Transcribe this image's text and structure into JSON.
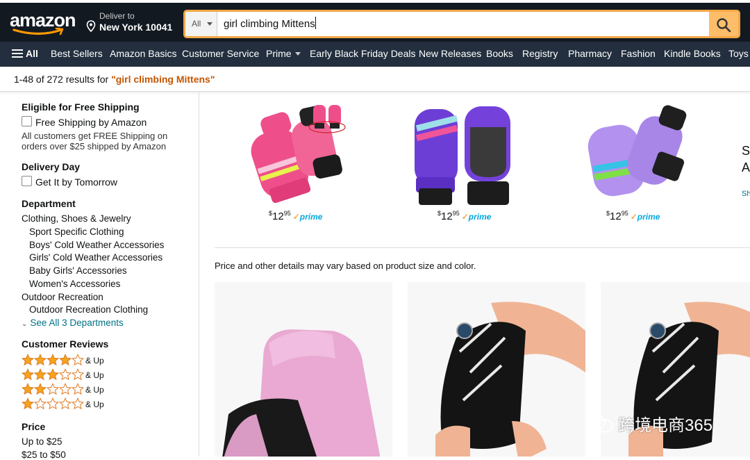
{
  "header": {
    "logo_text": "amazon",
    "deliver_label": "Deliver to",
    "deliver_location": "New York 10041",
    "search_category": "All",
    "search_query": "girl climbing Mittens"
  },
  "nav": {
    "items": [
      "All",
      "Best Sellers",
      "Amazon Basics",
      "Customer Service",
      "Prime",
      "Early Black Friday Deals",
      "New Releases",
      "Books",
      "Registry",
      "Pharmacy",
      "Fashion",
      "Kindle Books",
      "Toys"
    ]
  },
  "results": {
    "count_text": "1-48 of 272 results for ",
    "query_text": "\"girl climbing Mittens\""
  },
  "sidebar": {
    "shipping_heading": "Eligible for Free Shipping",
    "shipping_option": "Free Shipping by Amazon",
    "shipping_note": "All customers get FREE Shipping on orders over $25 shipped by Amazon",
    "delivery_heading": "Delivery Day",
    "delivery_option": "Get It by Tomorrow",
    "department_heading": "Department",
    "departments": [
      {
        "label": "Clothing, Shoes & Jewelry"
      },
      {
        "label": "Sport Specific Clothing"
      },
      {
        "label": "Boys' Cold Weather Accessories"
      },
      {
        "label": "Girls' Cold Weather Accessories"
      },
      {
        "label": "Baby Girls' Accessories"
      },
      {
        "label": "Women's Accessories"
      },
      {
        "label": "Outdoor Recreation"
      },
      {
        "label": "Outdoor Recreation Clothing"
      }
    ],
    "see_all": "See All 3 Departments",
    "reviews_heading": "Customer Reviews",
    "review_rows": [
      {
        "stars": 4,
        "label": "& Up"
      },
      {
        "stars": 3,
        "label": "& Up"
      },
      {
        "stars": 2,
        "label": "& Up"
      },
      {
        "stars": 1,
        "label": "& Up"
      }
    ],
    "price_heading": "Price",
    "price_ranges": [
      "Up to $25",
      "$25 to $50"
    ]
  },
  "sponsored": {
    "products": [
      {
        "price_whole": "12",
        "price_frac": "95",
        "prime": "prime"
      },
      {
        "price_whole": "12",
        "price_frac": "95",
        "prime": "prime"
      },
      {
        "price_whole": "12",
        "price_frac": "95",
        "prime": "prime"
      }
    ],
    "side_title_1": "Sl",
    "side_title_2": "A",
    "side_link": "Sh"
  },
  "main": {
    "price_note": "Price and other details may vary based on product size and color."
  },
  "watermark": {
    "text": "跨境电商365"
  },
  "colors": {
    "topbar": "#131921",
    "navbar": "#232f3e",
    "search_border": "#f3a847",
    "search_button": "#febd69",
    "result_term": "#c45500",
    "link": "#007185",
    "star": "#f4a41d",
    "prime": "#00a8e1"
  },
  "icons": {
    "location": "location-pin-icon",
    "search": "magnifier-icon",
    "menu": "hamburger-icon",
    "star": "star-icon"
  }
}
